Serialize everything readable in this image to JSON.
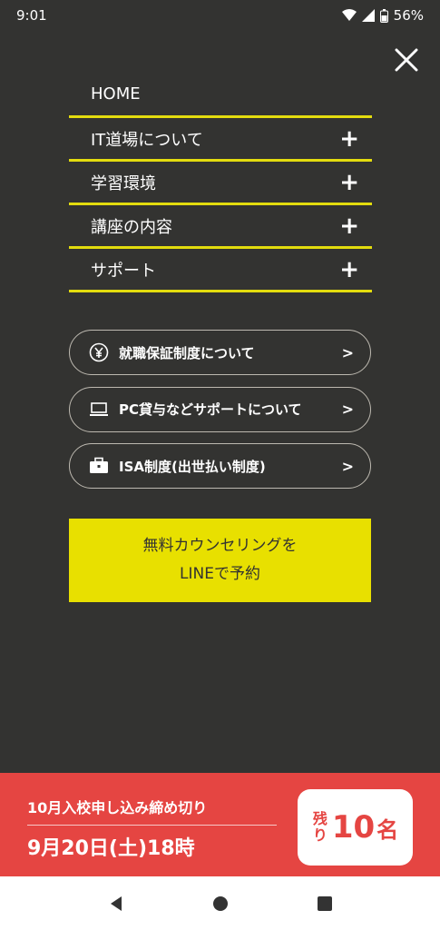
{
  "status": {
    "time": "9:01",
    "battery": "56%"
  },
  "menu": {
    "items": [
      {
        "label": "HOME",
        "expandable": false
      },
      {
        "label": "IT道場について",
        "expandable": true
      },
      {
        "label": "学習環境",
        "expandable": true
      },
      {
        "label": "講座の内容",
        "expandable": true
      },
      {
        "label": "サポート",
        "expandable": true
      }
    ],
    "expand_symbol": "+"
  },
  "links": [
    {
      "icon": "yen-icon",
      "label": "就職保証制度について"
    },
    {
      "icon": "laptop-icon",
      "label": "PC貸与などサポートについて"
    },
    {
      "icon": "briefcase-icon",
      "label": "ISA制度(出世払い制度)"
    }
  ],
  "chevron": ">",
  "cta": {
    "line1": "無料カウンセリングを",
    "line2": "LINEで予約"
  },
  "banner": {
    "deadline_label": "10月入校申し込み締め切り",
    "deadline_date": "9月20日(土)18時",
    "remaining_prefix": "残り",
    "remaining_count": "10",
    "remaining_unit": "名"
  },
  "colors": {
    "background": "#333331",
    "accent": "#e8e000",
    "banner": "#e54542"
  }
}
